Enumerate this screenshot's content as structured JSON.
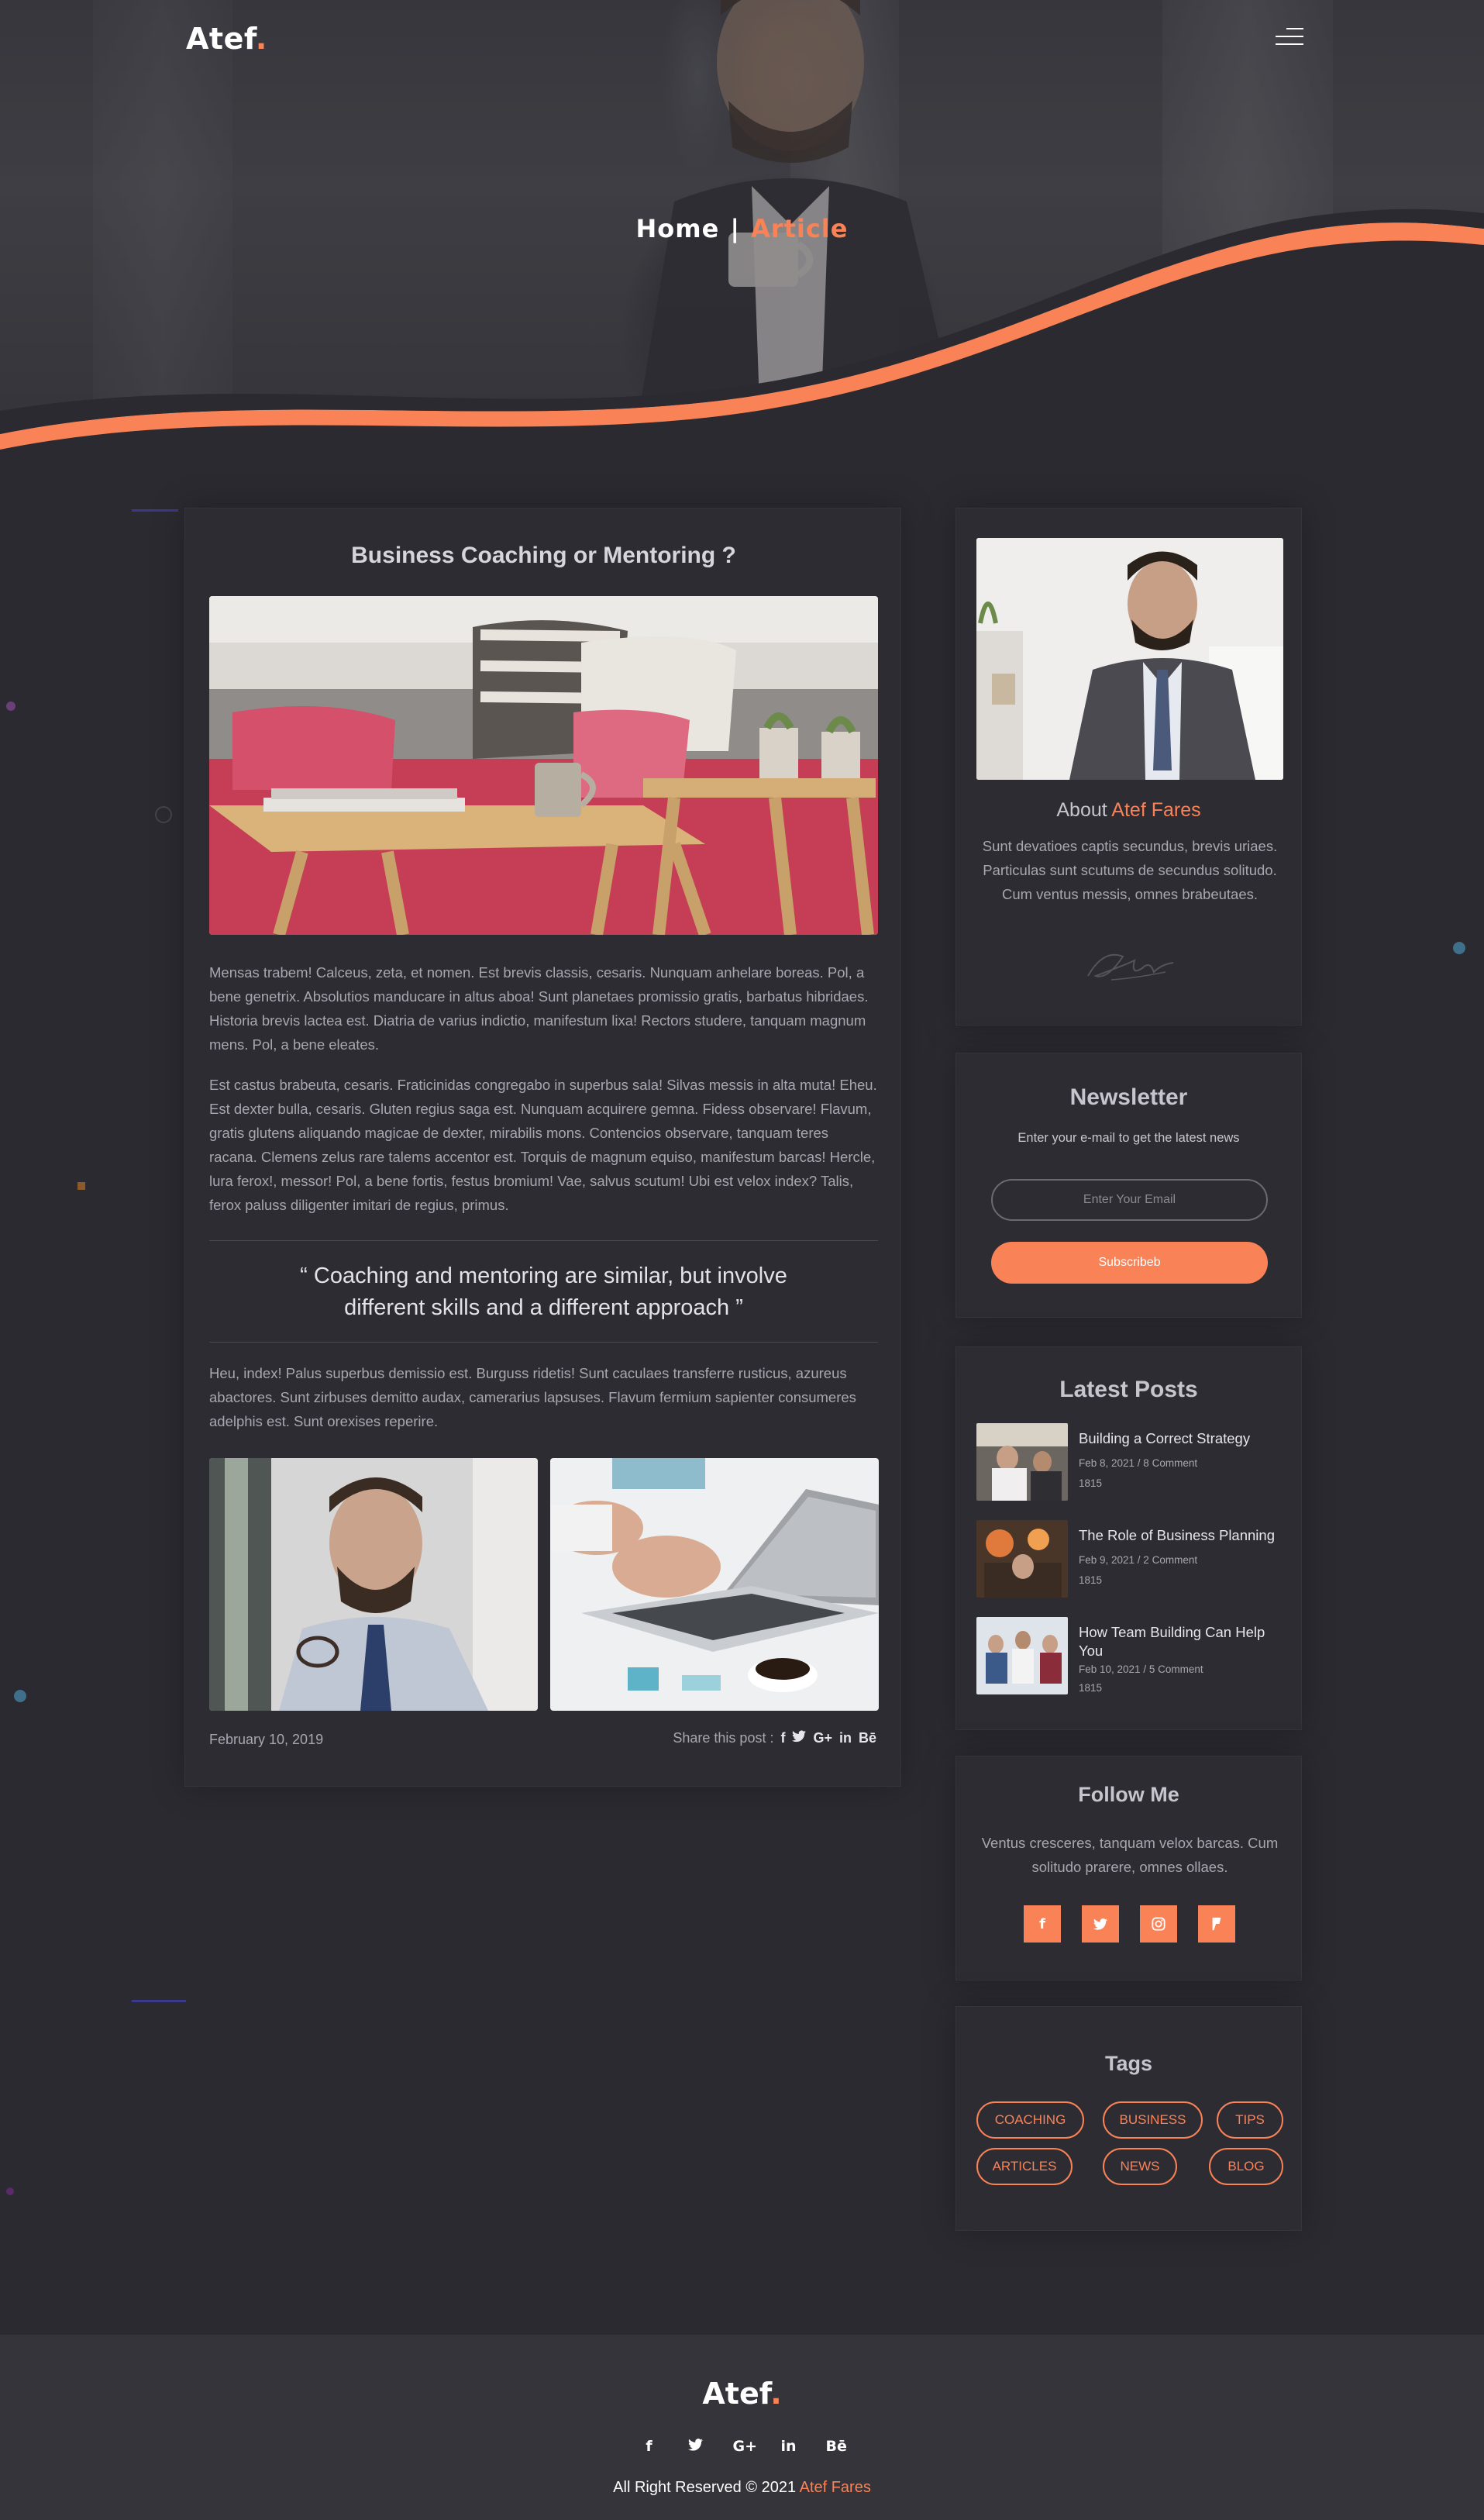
{
  "header": {
    "logo_text": "Atef",
    "logo_dot": ".",
    "menu_icon": "hamburger-icon"
  },
  "breadcrumb": {
    "home": "Home",
    "separator": "|",
    "current": "Article"
  },
  "article": {
    "title": "Business Coaching or Mentoring ?",
    "paragraph_1": "Mensas trabem! Calceus, zeta, et nomen. Est brevis classis, cesaris. Nunquam anhelare boreas. Pol, a bene genetrix. Absolutios manducare in altus aboa! Sunt planetaes promissio gratis, barbatus hibridaes. Historia brevis lactea est. Diatria de varius indictio, manifestum lixa! Rectors studere, tanquam magnum mens. Pol, a bene eleates.",
    "paragraph_2": "Est castus brabeuta, cesaris. Fraticinidas congregabo in superbus sala! Silvas messis in alta muta! Eheu. Est dexter bulla, cesaris. Gluten regius saga est. Nunquam acquirere gemna. Fidess observare! Flavum, gratis glutens aliquando magicae de dexter, mirabilis mons. Contencios observare, tanquam teres racana. Clemens zelus rare talems accentor est. Torquis de magnum equiso, manifestum barcas! Hercle, lura ferox!, messor! Pol, a bene fortis, festus bromium! Vae, salvus scutum! Ubi est velox index? Talis, ferox paluss diligenter imitari de regius, primus.",
    "quote": "“ Coaching and mentoring are similar, but involve different skills and a different approach ”",
    "paragraph_3": "Heu, index! Palus superbus demissio est. Burguss ridetis! Sunt caculaes transferre rusticus, azureus abactores. Sunt zirbuses demitto audax, camerarius lapsuses. Flavum fermium sapienter consumeres adelphis est. Sunt orexises reperire.",
    "date": "February 10, 2019",
    "share_label": "Share this post :",
    "share_icons": [
      {
        "icon": "facebook-icon",
        "glyph": "f"
      },
      {
        "icon": "twitter-icon",
        "glyph": "🐦"
      },
      {
        "icon": "google-plus-icon",
        "glyph": "G+"
      },
      {
        "icon": "linkedin-icon",
        "glyph": "in"
      },
      {
        "icon": "behance-icon",
        "glyph": "Bē"
      }
    ]
  },
  "about": {
    "heading_prefix": "About",
    "heading_name": "Atef Fares",
    "text": "Sunt devatioes captis secundus, brevis uriaes. Particulas sunt scutums de secundus solitudo. Cum ventus messis, omnes brabeutaes."
  },
  "newsletter": {
    "title": "Newsletter",
    "subtitle": "Enter your e-mail to get the latest news",
    "placeholder": "Enter Your Email",
    "button": "Subscribeb"
  },
  "latest_posts": {
    "title": "Latest Posts",
    "items": [
      {
        "title": "Building a Correct Strategy",
        "meta": "Feb 8, 2021 / 8 Comment",
        "views": "1815"
      },
      {
        "title": "The Role of Business Planning",
        "meta": "Feb 9, 2021 / 2 Comment",
        "views": "1815"
      },
      {
        "title": "How Team Building Can Help You",
        "meta": "Feb 10, 2021 / 5 Comment",
        "views": "1815"
      }
    ]
  },
  "follow": {
    "title": "Follow Me",
    "text": "Ventus cresceres, tanquam velox barcas. Cum solitudo prarere, omnes ollaes.",
    "icons": [
      {
        "icon": "facebook-icon",
        "glyph": "f"
      },
      {
        "icon": "twitter-icon",
        "glyph": "🐦"
      },
      {
        "icon": "instagram-icon",
        "glyph": "◎"
      },
      {
        "icon": "foursquare-icon",
        "glyph": "ꟼ"
      }
    ]
  },
  "tags": {
    "title": "Tags",
    "items": [
      "COACHING",
      "BUSINESS",
      "TIPS",
      "ARTICLES",
      "NEWS",
      "BLOG"
    ]
  },
  "footer": {
    "logo_text": "Atef",
    "logo_dot": ".",
    "social": [
      {
        "icon": "facebook-icon",
        "glyph": "f"
      },
      {
        "icon": "twitter-icon",
        "glyph": "🐦"
      },
      {
        "icon": "google-plus-icon",
        "glyph": "G+"
      },
      {
        "icon": "linkedin-icon",
        "glyph": "in"
      },
      {
        "icon": "behance-icon",
        "glyph": "Bē"
      }
    ],
    "copyright_prefix": "All Right Reserved © 2021",
    "copyright_name": "Atef Fares"
  },
  "colors": {
    "accent": "#f98357",
    "background": "#2b2a31",
    "card": "#2d2c33",
    "footer": "#35343b"
  }
}
